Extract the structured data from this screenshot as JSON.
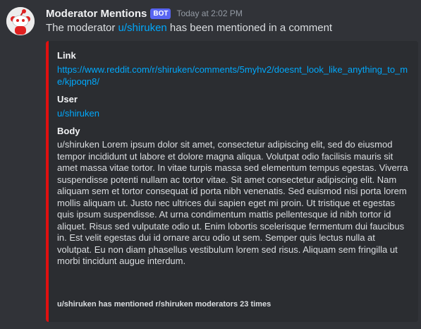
{
  "message": {
    "author": "Moderator Mentions",
    "bot_tag": "BOT",
    "timestamp": "Today at 2:02 PM",
    "content_prefix": "The moderator ",
    "content_mention": "u/shiruken",
    "content_suffix": " has been mentioned in a comment",
    "accent_color": "#e01010",
    "avatar_icon": "reddit-snoo-icon"
  },
  "embed": {
    "link_label": "Link",
    "link_url": "https://www.reddit.com/r/shiruken/comments/5myhv2/doesnt_look_like_anything_to_me/kjpoqn8/",
    "user_label": "User",
    "user_value": "u/shiruken",
    "body_label": "Body",
    "body_text": "u/shiruken Lorem ipsum dolor sit amet, consectetur adipiscing elit, sed do eiusmod tempor incididunt ut labore et dolore magna aliqua. Volutpat odio facilisis mauris sit amet massa vitae tortor. In vitae turpis massa sed elementum tempus egestas. Viverra suspendisse potenti nullam ac tortor vitae. Sit amet consectetur adipiscing elit. Nam aliquam sem et tortor consequat id porta nibh venenatis. Sed euismod nisi porta lorem mollis aliquam ut. Justo nec ultrices dui sapien eget mi proin. Ut tristique et egestas quis ipsum suspendisse. At urna condimentum mattis pellentesque id nibh tortor id aliquet. Risus sed vulputate odio ut. Enim lobortis scelerisque fermentum dui faucibus in. Est velit egestas dui id ornare arcu odio ut sem. Semper quis lectus nulla at volutpat. Eu non diam phasellus vestibulum lorem sed risus. Aliquam sem fringilla ut morbi tincidunt augue interdum.",
    "footer": "u/shiruken has mentioned r/shiruken moderators 23 times"
  }
}
